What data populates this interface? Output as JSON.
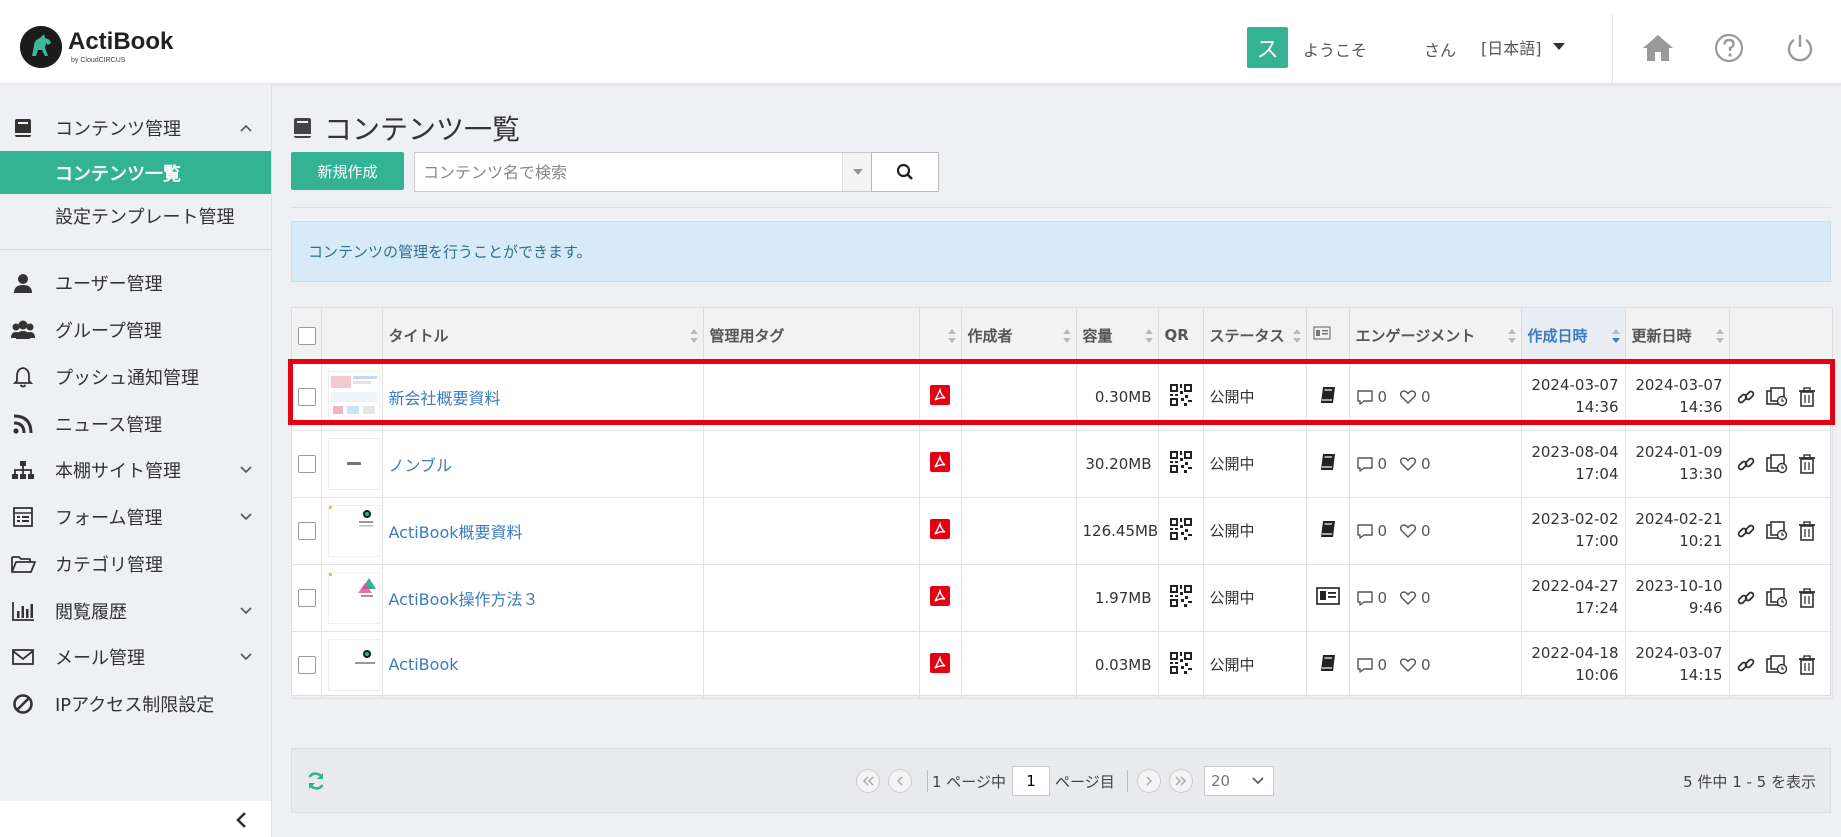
{
  "app": {
    "logo_name": "ActiBook",
    "logo_sub": "by CloudCIRCUS"
  },
  "header": {
    "user_initial": "ス",
    "welcome": "ようこそ",
    "san": "さん",
    "language": "[日本語]",
    "icons": [
      "home-icon",
      "help-icon",
      "power-icon"
    ]
  },
  "sidebar": {
    "content_mgmt": "コンテンツ管理",
    "content_list": "コンテンツ一覧",
    "template_mgmt": "設定テンプレート管理",
    "user_mgmt": "ユーザー管理",
    "group_mgmt": "グループ管理",
    "push_mgmt": "プッシュ通知管理",
    "news_mgmt": "ニュース管理",
    "shelf_mgmt": "本棚サイト管理",
    "form_mgmt": "フォーム管理",
    "category_mgmt": "カテゴリ管理",
    "history": "閲覧履歴",
    "mail_mgmt": "メール管理",
    "ip_restrict": "IPアクセス制限設定"
  },
  "main": {
    "page_title": "コンテンツ一覧",
    "new_button": "新規作成",
    "search_placeholder": "コンテンツ名で検索",
    "info": "コンテンツの管理を行うことができます。"
  },
  "table": {
    "headers": {
      "title": "タイトル",
      "tag": "管理用タグ",
      "creator": "作成者",
      "size": "容量",
      "qr": "QR",
      "status": "ステータス",
      "engagement": "エンゲージメント",
      "created": "作成日時",
      "updated": "更新日時"
    },
    "rows": [
      {
        "title": "新会社概要資料",
        "tag": "",
        "creator": "",
        "size": "0.30MB",
        "status": "公開中",
        "comments": "0",
        "likes": "0",
        "created_date": "2024-03-07",
        "created_time": "14:36",
        "updated_date": "2024-03-07",
        "updated_time": "14:36",
        "view": "book"
      },
      {
        "title": "ノンブル",
        "tag": "",
        "creator": "",
        "size": "30.20MB",
        "status": "公開中",
        "comments": "0",
        "likes": "0",
        "created_date": "2023-08-04",
        "created_time": "17:04",
        "updated_date": "2024-01-09",
        "updated_time": "13:30",
        "view": "book"
      },
      {
        "title": "ActiBook概要資料",
        "tag": "",
        "creator": "",
        "size": "126.45MB",
        "status": "公開中",
        "comments": "0",
        "likes": "0",
        "created_date": "2023-02-02",
        "created_time": "17:00",
        "updated_date": "2024-02-21",
        "updated_time": "10:21",
        "view": "book"
      },
      {
        "title": "ActiBook操作方法３",
        "tag": "",
        "creator": "",
        "size": "1.97MB",
        "status": "公開中",
        "comments": "0",
        "likes": "0",
        "created_date": "2022-04-27",
        "created_time": "17:24",
        "updated_date": "2023-10-10",
        "updated_time": "9:46",
        "view": "card"
      },
      {
        "title": "ActiBook",
        "tag": "",
        "creator": "",
        "size": "0.03MB",
        "status": "公開中",
        "comments": "0",
        "likes": "0",
        "created_date": "2022-04-18",
        "created_time": "10:06",
        "updated_date": "2024-03-07",
        "updated_time": "14:15",
        "view": "book"
      }
    ]
  },
  "pager": {
    "page_of": "1 ページ中",
    "current_page": "1",
    "page_suffix": "ページ目",
    "per_page": "20",
    "summary": "5 件中 1 - 5 を表示"
  },
  "colors": {
    "accent": "#33b294",
    "link": "#3b7bbf",
    "highlight": "#e60012",
    "info_bg": "#d6ebf7",
    "pdf": "#e60012"
  }
}
